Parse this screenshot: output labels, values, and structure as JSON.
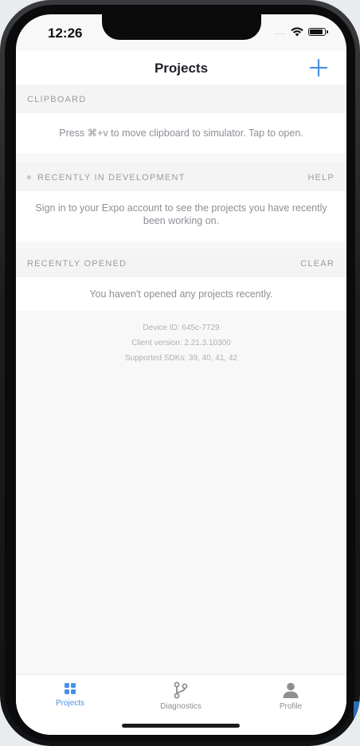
{
  "status_bar": {
    "time": "12:26",
    "signal_dots": "....",
    "icons": [
      "wifi-icon",
      "battery-icon"
    ]
  },
  "nav": {
    "title": "Projects",
    "add_icon": "plus-icon"
  },
  "sections": {
    "clipboard": {
      "header": "CLIPBOARD",
      "message": "Press ⌘+v to move clipboard to simulator. Tap to open."
    },
    "recently_in_development": {
      "header": "RECENTLY IN DEVELOPMENT",
      "action": "HELP",
      "message": "Sign in to your Expo account to see the projects you have recently been working on."
    },
    "recently_opened": {
      "header": "RECENTLY OPENED",
      "action": "CLEAR",
      "message": "You haven't opened any projects recently."
    }
  },
  "info": {
    "device_id": "Device ID: 645c-7729",
    "client_version": "Client version: 2.21.3.10300",
    "supported_sdks": "Supported SDKs: 39, 40, 41, 42"
  },
  "tabs": [
    {
      "label": "Projects",
      "icon": "grid-icon",
      "active": true
    },
    {
      "label": "Diagnostics",
      "icon": "git-branch-icon",
      "active": false
    },
    {
      "label": "Profile",
      "icon": "person-icon",
      "active": false
    }
  ],
  "colors": {
    "accent": "#4a90e2",
    "background": "#f8f8f8",
    "muted_text": "#8d8f96"
  }
}
